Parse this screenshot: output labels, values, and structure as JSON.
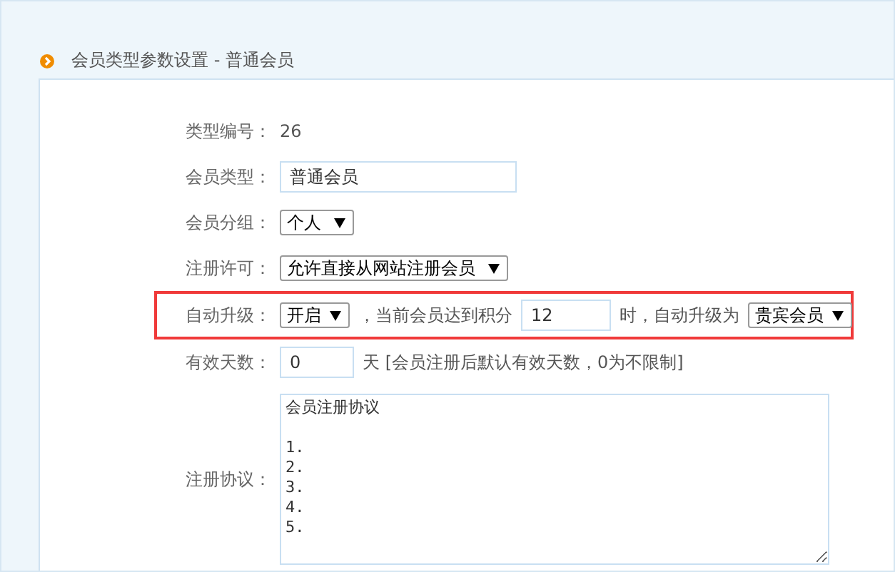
{
  "header": {
    "title": "会员类型参数设置 - 普通会员"
  },
  "fields": [
    {
      "label": "类型编号：",
      "kind": "text",
      "highlighted": false,
      "value": "26"
    },
    {
      "label": "会员类型：",
      "kind": "input",
      "highlighted": false,
      "value": "普通会员"
    },
    {
      "label": "会员分组：",
      "kind": "select",
      "highlighted": false,
      "value": "个人"
    },
    {
      "label": "注册许可：",
      "kind": "select",
      "highlighted": false,
      "value": "允许直接从网站注册会员"
    },
    {
      "label": "自动升级：",
      "kind": "compound",
      "highlighted": true,
      "parts": [
        {
          "kind": "select",
          "value": "开启"
        },
        {
          "kind": "text",
          "value": "，当前会员达到积分"
        },
        {
          "kind": "input",
          "value": "12"
        },
        {
          "kind": "text",
          "value": "时，自动升级为"
        },
        {
          "kind": "select",
          "value": "贵宾会员"
        }
      ]
    },
    {
      "label": "有效天数：",
      "kind": "compound",
      "highlighted": false,
      "parts": [
        {
          "kind": "input",
          "value": "0"
        },
        {
          "kind": "text",
          "value": "天 [会员注册后默认有效天数，0为不限制]"
        }
      ]
    },
    {
      "label": "注册协议：",
      "kind": "textarea",
      "highlighted": false,
      "value": "会员注册协议\n\n1.\n2.\n3.\n4.\n5."
    }
  ]
}
